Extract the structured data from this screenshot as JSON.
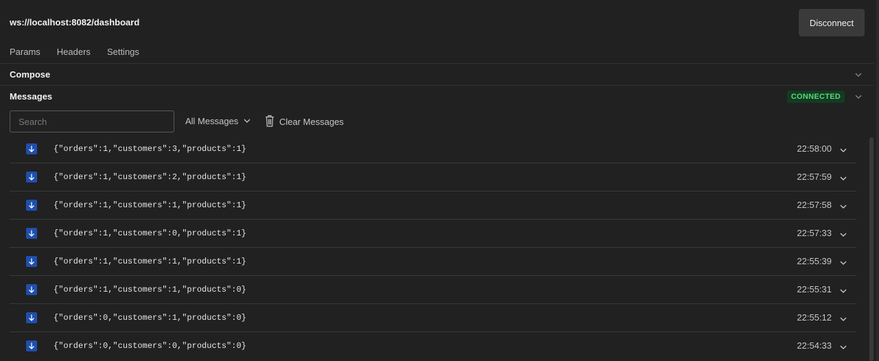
{
  "header": {
    "url": "ws://localhost:8082/dashboard",
    "disconnect_label": "Disconnect"
  },
  "tabs": [
    {
      "label": "Params"
    },
    {
      "label": "Headers"
    },
    {
      "label": "Settings"
    }
  ],
  "compose": {
    "title": "Compose"
  },
  "messages_section": {
    "title": "Messages",
    "status": "CONNECTED",
    "search_placeholder": "Search",
    "filter_label": "All Messages",
    "clear_label": "Clear Messages"
  },
  "messages": [
    {
      "text": "{\"orders\":1,\"customers\":3,\"products\":1}",
      "time": "22:58:00",
      "direction": "incoming"
    },
    {
      "text": "{\"orders\":1,\"customers\":2,\"products\":1}",
      "time": "22:57:59",
      "direction": "incoming"
    },
    {
      "text": "{\"orders\":1,\"customers\":1,\"products\":1}",
      "time": "22:57:58",
      "direction": "incoming"
    },
    {
      "text": "{\"orders\":1,\"customers\":0,\"products\":1}",
      "time": "22:57:33",
      "direction": "incoming"
    },
    {
      "text": "{\"orders\":1,\"customers\":1,\"products\":1}",
      "time": "22:55:39",
      "direction": "incoming"
    },
    {
      "text": "{\"orders\":1,\"customers\":1,\"products\":0}",
      "time": "22:55:31",
      "direction": "incoming"
    },
    {
      "text": "{\"orders\":0,\"customers\":1,\"products\":0}",
      "time": "22:55:12",
      "direction": "incoming"
    },
    {
      "text": "{\"orders\":0,\"customers\":0,\"products\":0}",
      "time": "22:54:33",
      "direction": "incoming"
    }
  ],
  "colors": {
    "background": "#212121",
    "status_badge_bg": "#133b22",
    "status_badge_text": "#5dd67a",
    "incoming_icon_bg": "#1f4fae"
  },
  "icons": {
    "incoming": "arrow-down-icon",
    "expand": "chevron-down-icon",
    "clear": "trash-icon"
  }
}
